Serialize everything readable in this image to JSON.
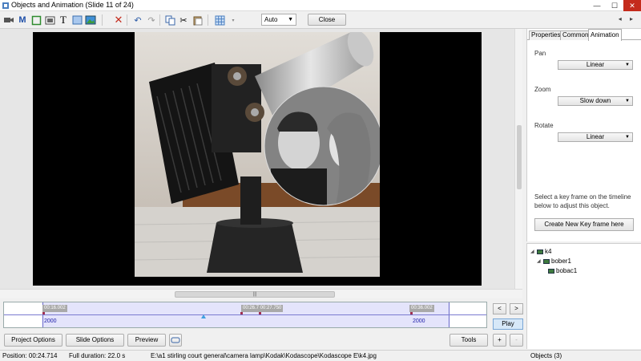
{
  "window": {
    "title": "Objects and Animation  (Slide 11 of 24)",
    "controls": {
      "minimize": "—",
      "maximize": "☐",
      "close": "✕"
    }
  },
  "toolbar": {
    "icons": [
      "camera-icon",
      "mask-icon",
      "frame-icon",
      "image-icon",
      "text-icon",
      "rectangle-icon",
      "picture-icon",
      "delete-icon",
      "undo-icon",
      "redo-icon",
      "copy-icon",
      "cut-icon",
      "paste-icon",
      "grid-icon"
    ],
    "letter_m": "M",
    "letter_t": "T",
    "auto_select": "Auto",
    "close_label": "Close",
    "nav_arrows": "◂ ▸"
  },
  "panel": {
    "tabs": [
      {
        "label": "Properties",
        "active": false
      },
      {
        "label": "Common",
        "active": false
      },
      {
        "label": "Animation",
        "active": true
      }
    ],
    "pan": {
      "label": "Pan",
      "value": "Linear"
    },
    "zoom": {
      "label": "Zoom",
      "value": "Slow down"
    },
    "rotate": {
      "label": "Rotate",
      "value": "Linear"
    },
    "hint": "Select a key frame on the timeline below to adjust this object.",
    "keyframe_button": "Create New Key frame here"
  },
  "tree": {
    "items": [
      {
        "label": "k4",
        "level": 0
      },
      {
        "label": "bober1",
        "level": 1
      },
      {
        "label": "bobac1",
        "level": 2
      }
    ]
  },
  "timeline": {
    "markers": [
      {
        "label": "00:16.002",
        "value": "2000"
      },
      {
        "label": "00:26.7 00:27.750",
        "value": ""
      },
      {
        "label": "00:36.002",
        "value": "2000"
      }
    ],
    "prev": "<",
    "next": ">",
    "play": "Play",
    "add": "+",
    "remove": "-"
  },
  "bottom": {
    "project_options": "Project Options",
    "slide_options": "Slide Options",
    "preview": "Preview",
    "tools": "Tools"
  },
  "status": {
    "position": "Position:  00:24.714",
    "duration": "Full duration:  22.0 s",
    "path": "E:\\a1 stirling court general\\camera lamp\\Kodak\\Kodascope\\Kodascope E\\k4.jpg",
    "objects": "Objects (3)"
  },
  "colors": {
    "accent": "#6767c9",
    "close_red": "#c42b1c",
    "play_bg": "#d7e8f8"
  }
}
